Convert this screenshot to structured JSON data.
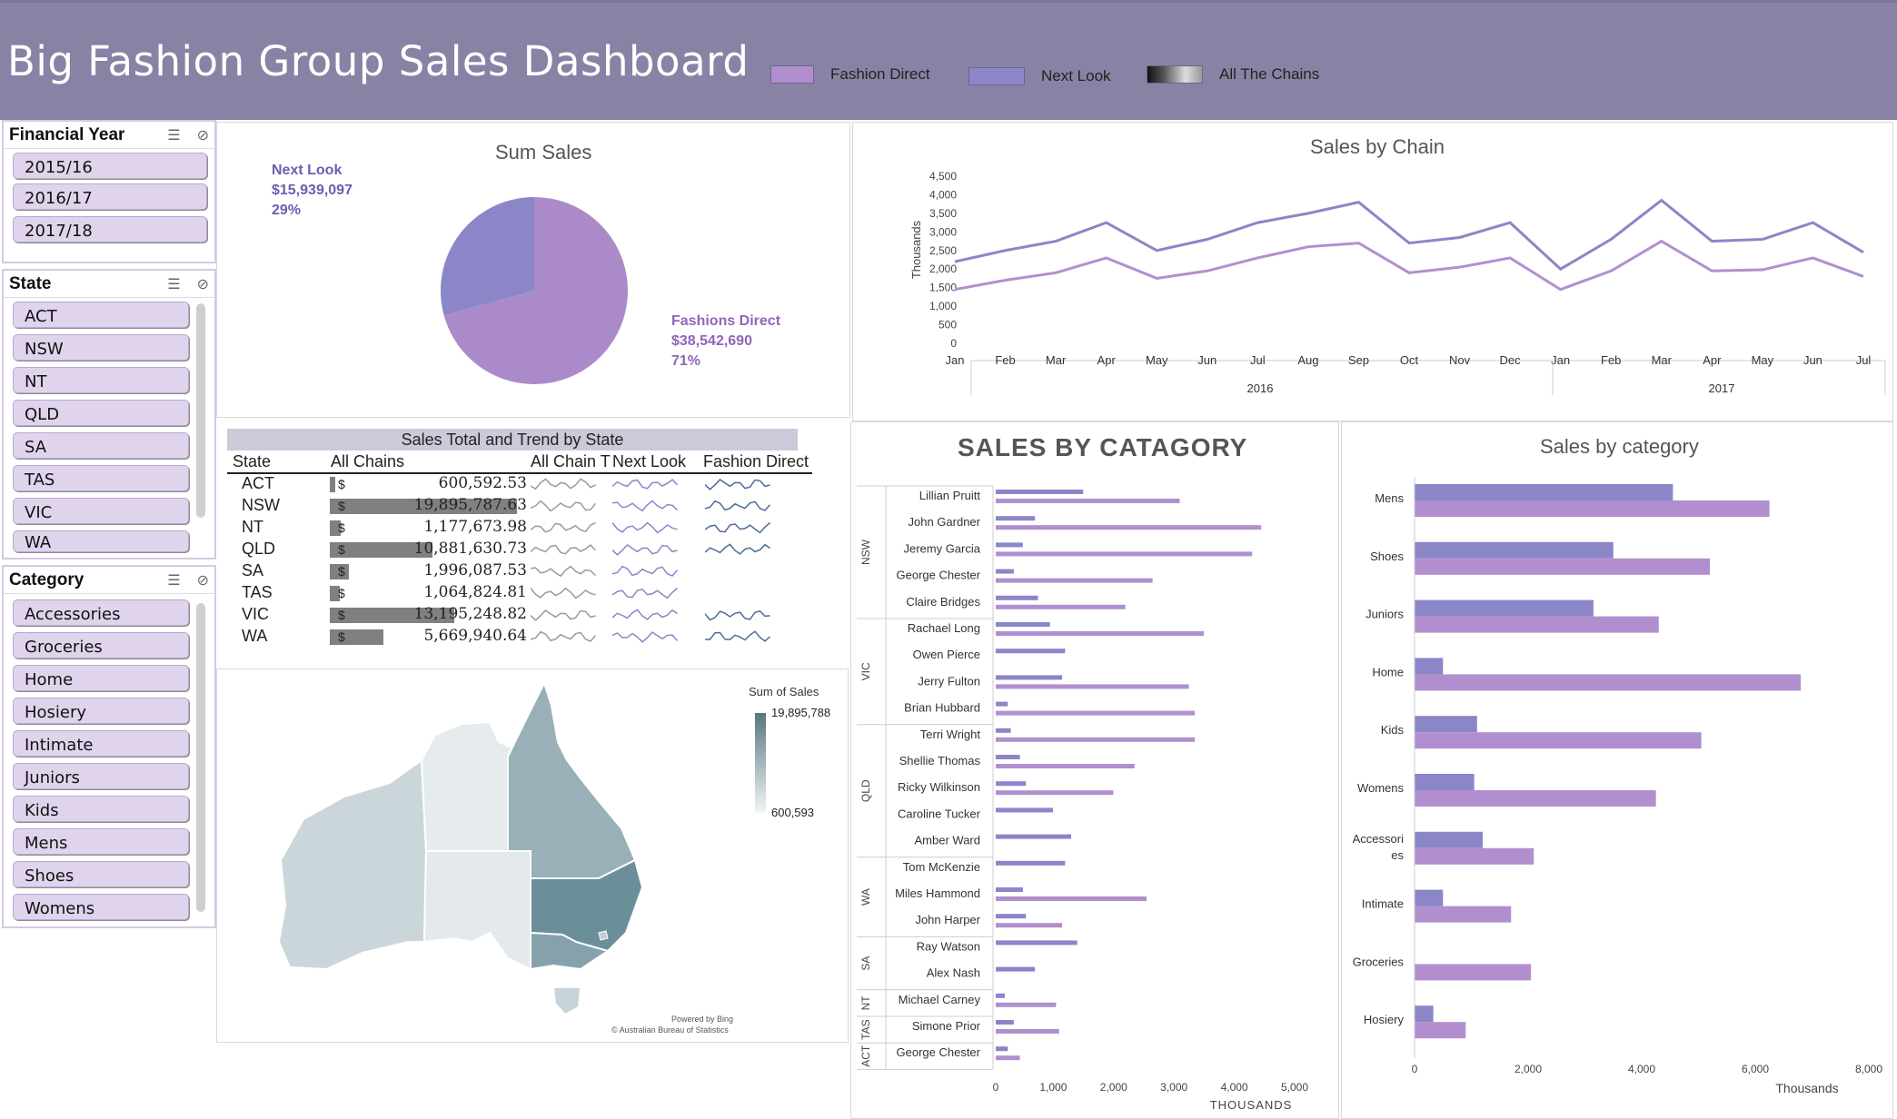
{
  "header": {
    "title": "Big Fashion Group Sales Dashboard",
    "legend": [
      {
        "label": "Fashion Direct",
        "color": "#b18fcf"
      },
      {
        "label": "Next Look",
        "color": "#8a86c8"
      },
      {
        "label": "All The Chains",
        "color": "gradient"
      }
    ]
  },
  "slicers": {
    "financial_year": {
      "title": "Financial Year",
      "items": [
        "2015/16",
        "2016/17",
        "2017/18"
      ]
    },
    "state": {
      "title": "State",
      "items": [
        "ACT",
        "NSW",
        "NT",
        "QLD",
        "SA",
        "TAS",
        "VIC",
        "WA"
      ]
    },
    "category": {
      "title": "Category",
      "items": [
        "Accessories",
        "Groceries",
        "Home",
        "Hosiery",
        "Intimate",
        "Juniors",
        "Kids",
        "Mens",
        "Shoes",
        "Womens"
      ]
    }
  },
  "sum_sales": {
    "title": "Sum Sales",
    "next_look": {
      "name": "Next Look",
      "value": "$15,939,097",
      "pct": "29%"
    },
    "fashions_direct": {
      "name": "Fashions Direct",
      "value": "$38,542,690",
      "pct": "71%"
    },
    "chart_data": {
      "type": "pie",
      "categories": [
        "Next Look",
        "Fashions Direct"
      ],
      "values": [
        15939097,
        38542690
      ],
      "colors": [
        "#8a86c8",
        "#ab8ac9"
      ]
    }
  },
  "sales_by_chain": {
    "title": "Sales by Chain",
    "ylabel": "Thousands",
    "yticks": [
      "4,500",
      "4,000",
      "3,500",
      "3,000",
      "2,500",
      "2,000",
      "1,500",
      "1,000",
      "500",
      "0"
    ],
    "months": [
      "Jan",
      "Feb",
      "Mar",
      "Apr",
      "May",
      "Jun",
      "Jul",
      "Aug",
      "Sep",
      "Oct",
      "Nov",
      "Dec",
      "Jan",
      "Feb",
      "Mar",
      "Apr",
      "May",
      "Jun",
      "Jul"
    ],
    "years": [
      "2016",
      "2017"
    ],
    "chart_data": {
      "type": "line",
      "x": [
        "Jan 2016",
        "Feb 2016",
        "Mar 2016",
        "Apr 2016",
        "May 2016",
        "Jun 2016",
        "Jul 2016",
        "Aug 2016",
        "Sep 2016",
        "Oct 2016",
        "Nov 2016",
        "Dec 2016",
        "Jan 2017",
        "Feb 2017",
        "Mar 2017",
        "Apr 2017",
        "May 2017",
        "Jun 2017",
        "Jul 2017"
      ],
      "ylim": [
        0,
        4500
      ],
      "series": [
        {
          "color": "#8a86c8",
          "values": [
            2200,
            2500,
            2750,
            3250,
            2500,
            2800,
            3250,
            3500,
            3800,
            2700,
            2850,
            3250,
            2000,
            2800,
            3850,
            2750,
            2800,
            3250,
            2450
          ]
        },
        {
          "color": "#b18fcf",
          "values": [
            1450,
            1700,
            1900,
            2300,
            1750,
            1950,
            2300,
            2600,
            2700,
            1900,
            2050,
            2300,
            1450,
            1950,
            2750,
            1950,
            1980,
            2300,
            1800
          ]
        }
      ]
    }
  },
  "state_table": {
    "title": "Sales Total and Trend by State",
    "headers": [
      "State",
      "All Chains",
      "All Chain T",
      "Next Look",
      "Fashion Direct"
    ],
    "rows": [
      {
        "state": "ACT",
        "value": "600,592.53",
        "num": 600592.53,
        "fd": true
      },
      {
        "state": "NSW",
        "value": "19,895,787.63",
        "num": 19895787.63,
        "fd": true
      },
      {
        "state": "NT",
        "value": "1,177,673.98",
        "num": 1177673.98,
        "fd": true
      },
      {
        "state": "QLD",
        "value": "10,881,630.73",
        "num": 10881630.73,
        "fd": true
      },
      {
        "state": "SA",
        "value": "1,996,087.53",
        "num": 1996087.53,
        "fd": false
      },
      {
        "state": "TAS",
        "value": "1,064,824.81",
        "num": 1064824.81,
        "fd": false
      },
      {
        "state": "VIC",
        "value": "13,195,248.82",
        "num": 13195248.82,
        "fd": true
      },
      {
        "state": "WA",
        "value": "5,669,940.64",
        "num": 5669940.64,
        "fd": true
      }
    ],
    "currency": "$"
  },
  "map": {
    "legend_title": "Sum of Sales",
    "max": "19,895,788",
    "min": "600,593",
    "credit1": "Powered by Bing",
    "credit2": "© Australian Bureau of Statistics"
  },
  "sales_by_catagory": {
    "title": "SALES BY CATAGORY",
    "xlabel": "THOUSANDS",
    "xticks": [
      "0",
      "1,000",
      "2,000",
      "3,000",
      "4,000",
      "5,000"
    ],
    "groups": [
      {
        "label": "NSW",
        "people": [
          "Lillian Pruitt",
          "John Gardner",
          "Jeremy Garcia",
          "George Chester",
          "Claire Bridges"
        ]
      },
      {
        "label": "VIC",
        "people": [
          "Rachael Long",
          "Owen Pierce",
          "Jerry Fulton",
          "Brian Hubbard"
        ]
      },
      {
        "label": "QLD",
        "people": [
          "Terri Wright",
          "Shellie Thomas",
          "Ricky Wilkinson",
          "Caroline Tucker",
          "Amber Ward"
        ]
      },
      {
        "label": "WA",
        "people": [
          "Tom McKenzie",
          "Miles Hammond",
          "John Harper"
        ]
      },
      {
        "label": "SA",
        "people": [
          "Ray Watson",
          "Alex Nash"
        ]
      },
      {
        "label": "NT",
        "people": [
          "Michael Carney"
        ]
      },
      {
        "label": "TAS",
        "people": [
          "Simone Prior"
        ]
      },
      {
        "label": "ACT",
        "people": [
          "George Chester"
        ]
      }
    ],
    "chart_data": {
      "type": "bar",
      "xlim": [
        0,
        5000
      ],
      "categories": [
        "Lillian Pruitt",
        "John Gardner",
        "Jeremy Garcia",
        "George Chester",
        "Claire Bridges",
        "Rachael Long",
        "Owen Pierce",
        "Jerry Fulton",
        "Brian Hubbard",
        "Terri Wright",
        "Shellie Thomas",
        "Ricky Wilkinson",
        "Caroline Tucker",
        "Amber Ward",
        "Tom McKenzie",
        "Miles Hammond",
        "John Harper",
        "Ray Watson",
        "Alex Nash",
        "Michael Carney",
        "Simone Prior",
        "George Chester"
      ],
      "series": [
        {
          "color": "#8a86c8",
          "values": [
            1450,
            650,
            450,
            300,
            700,
            900,
            1150,
            1100,
            200,
            250,
            400,
            500,
            950,
            1250,
            1150,
            450,
            500,
            1350,
            650,
            150,
            300,
            200
          ]
        },
        {
          "color": "#b18fcf",
          "values": [
            3050,
            4400,
            4250,
            2600,
            2150,
            3450,
            0,
            3200,
            3300,
            3300,
            2300,
            1950,
            0,
            0,
            0,
            2500,
            1100,
            0,
            0,
            1000,
            1050,
            400
          ]
        }
      ]
    }
  },
  "sales_by_category": {
    "title": "Sales by category",
    "xlabel": "Thousands",
    "xticks": [
      "0",
      "2,000",
      "4,000",
      "6,000",
      "8,000"
    ],
    "categories": [
      "Mens",
      "Shoes",
      "Juniors",
      "Home",
      "Kids",
      "Womens",
      "Accessori es",
      "Intimate",
      "Groceries",
      "Hosiery"
    ],
    "chart_data": {
      "type": "bar",
      "xlim": [
        0,
        8000
      ],
      "categories": [
        "Mens",
        "Shoes",
        "Juniors",
        "Home",
        "Kids",
        "Womens",
        "Accessories",
        "Intimate",
        "Groceries",
        "Hosiery"
      ],
      "series": [
        {
          "color": "#8a86c8",
          "values": [
            4550,
            3500,
            3150,
            500,
            1100,
            1050,
            1200,
            500,
            0,
            330
          ]
        },
        {
          "color": "#b18fcf",
          "values": [
            6250,
            5200,
            4300,
            6800,
            5050,
            4250,
            2100,
            1700,
            2050,
            900
          ]
        }
      ]
    }
  }
}
